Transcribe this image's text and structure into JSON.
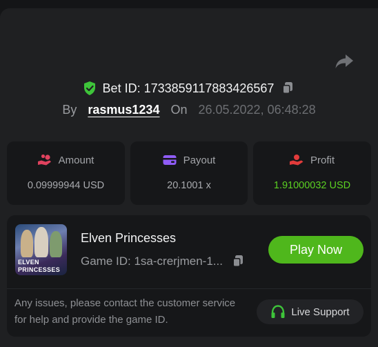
{
  "bet": {
    "label": "Bet ID: 1733859117883426567",
    "by_label": "By",
    "username": "rasmus1234",
    "on_label": "On",
    "datetime": "26.05.2022, 06:48:28"
  },
  "stats": [
    {
      "label": "Amount",
      "value": "0.09999944 USD",
      "icon": "coins-hand-icon",
      "icon_color": "#e0425e"
    },
    {
      "label": "Payout",
      "value": "20.1001 x",
      "icon": "wallet-icon",
      "icon_color": "#8f5cf6"
    },
    {
      "label": "Profit",
      "value": "1.91000032 USD",
      "icon": "hand-coin-icon",
      "icon_color": "#e23b3b",
      "value_color": "#5bd122"
    }
  ],
  "game": {
    "title": "Elven Princesses",
    "id_text": "Game ID: 1sa-crerjmen-1...",
    "thumb_line1": "ELVEN",
    "thumb_line2": "PRINCESSES",
    "play_label": "Play Now"
  },
  "footer": {
    "help_text": "Any issues, please contact the customer service for help and provide the game ID.",
    "support_label": "Live Support"
  },
  "colors": {
    "accent_green": "#4fb71c",
    "shield_green": "#3ec43a"
  }
}
